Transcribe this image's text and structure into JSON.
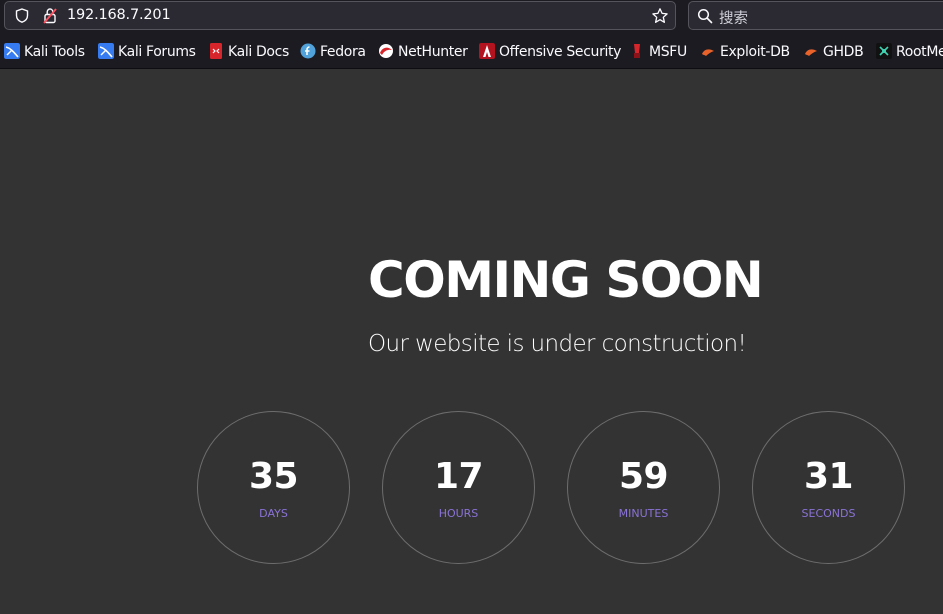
{
  "browser": {
    "url": "192.168.7.201",
    "search_placeholder": "搜索",
    "bookmarks": [
      {
        "label": "Kali Tools",
        "icon": "kali-icon"
      },
      {
        "label": "Kali Forums",
        "icon": "kali-icon"
      },
      {
        "label": "Kali Docs",
        "icon": "kali-docs-icon"
      },
      {
        "label": "Fedora",
        "icon": "fedora-icon"
      },
      {
        "label": "NetHunter",
        "icon": "nethunter-icon"
      },
      {
        "label": "Offensive Security",
        "icon": "offsec-icon"
      },
      {
        "label": "MSFU",
        "icon": "msfu-icon"
      },
      {
        "label": "Exploit-DB",
        "icon": "exploit-db-icon"
      },
      {
        "label": "GHDB",
        "icon": "ghdb-icon"
      },
      {
        "label": "RootMe",
        "icon": "rootme-icon"
      }
    ]
  },
  "page": {
    "headline": "COMING SOON",
    "subline": "Our website is under construction!",
    "countdown": [
      {
        "value": "35",
        "unit": "DAYS"
      },
      {
        "value": "17",
        "unit": "HOURS"
      },
      {
        "value": "59",
        "unit": "MINUTES"
      },
      {
        "value": "31",
        "unit": "SECONDS"
      }
    ]
  },
  "colors": {
    "page_background": "#333333",
    "toolbar_background": "#1c1b22",
    "accent_unit_text": "#8a73d6"
  }
}
